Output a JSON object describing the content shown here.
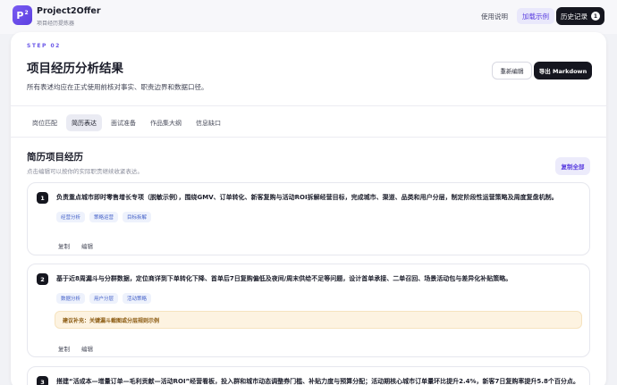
{
  "header": {
    "logo_text": "P",
    "logo_sup": "2",
    "brand_name": "Project2Offer",
    "brand_sub": "项目经历提炼器",
    "nav_help": "使用说明",
    "nav_sample": "加载示例",
    "history_label": "历史记录",
    "history_count": "1"
  },
  "page": {
    "step": "STEP 02",
    "title": "项目经历分析结果",
    "desc": "所有表述均应在正式使用前核对事实、职责边界和数据口径。",
    "reedit_label": "重新编辑",
    "export_label": "导出 Markdown"
  },
  "tabs": [
    {
      "label": "岗位匹配"
    },
    {
      "label": "简历表达"
    },
    {
      "label": "面试准备"
    },
    {
      "label": "作品集大纲"
    },
    {
      "label": "信息缺口"
    }
  ],
  "section": {
    "title": "简历项目经历",
    "hint": "点击编辑可以按你的实际职责继续收紧表达。",
    "copy_all": "复制全部"
  },
  "items": [
    {
      "num": "1",
      "text": "负责重点城市即时零售增长专项（脱敏示例），围绕GMV、订单转化、新客复购与活动ROI拆解经营目标，完成城市、渠道、品类和用户分层，制定阶段性运营策略及周度复盘机制。",
      "tags": [
        "经营分析",
        "策略运营",
        "目标拆解"
      ],
      "copy": "复制",
      "edit": "编辑"
    },
    {
      "num": "2",
      "text": "基于近8周漏斗与分群数据，定位商详到下单转化下降、首单后7日复购偏低及夜间/周末供给不足等问题，设计首单承接、二单召回、场景活动包与差异化补贴策略。",
      "tags": [
        "数据分析",
        "用户分层",
        "活动策略"
      ],
      "suggest": "建议补充：关键漏斗截图或分层规则示例",
      "copy": "复制",
      "edit": "编辑"
    },
    {
      "num": "3",
      "text": "搭建“活成本—增量订单—毛利贡献—活动ROI”经营看板，投入群和城市动态调整券门槛、补贴力度与预算分配；活动期核心城市订单量环比提升2.4%，新客7日复购率提升5.8个百分点。"
    }
  ]
}
